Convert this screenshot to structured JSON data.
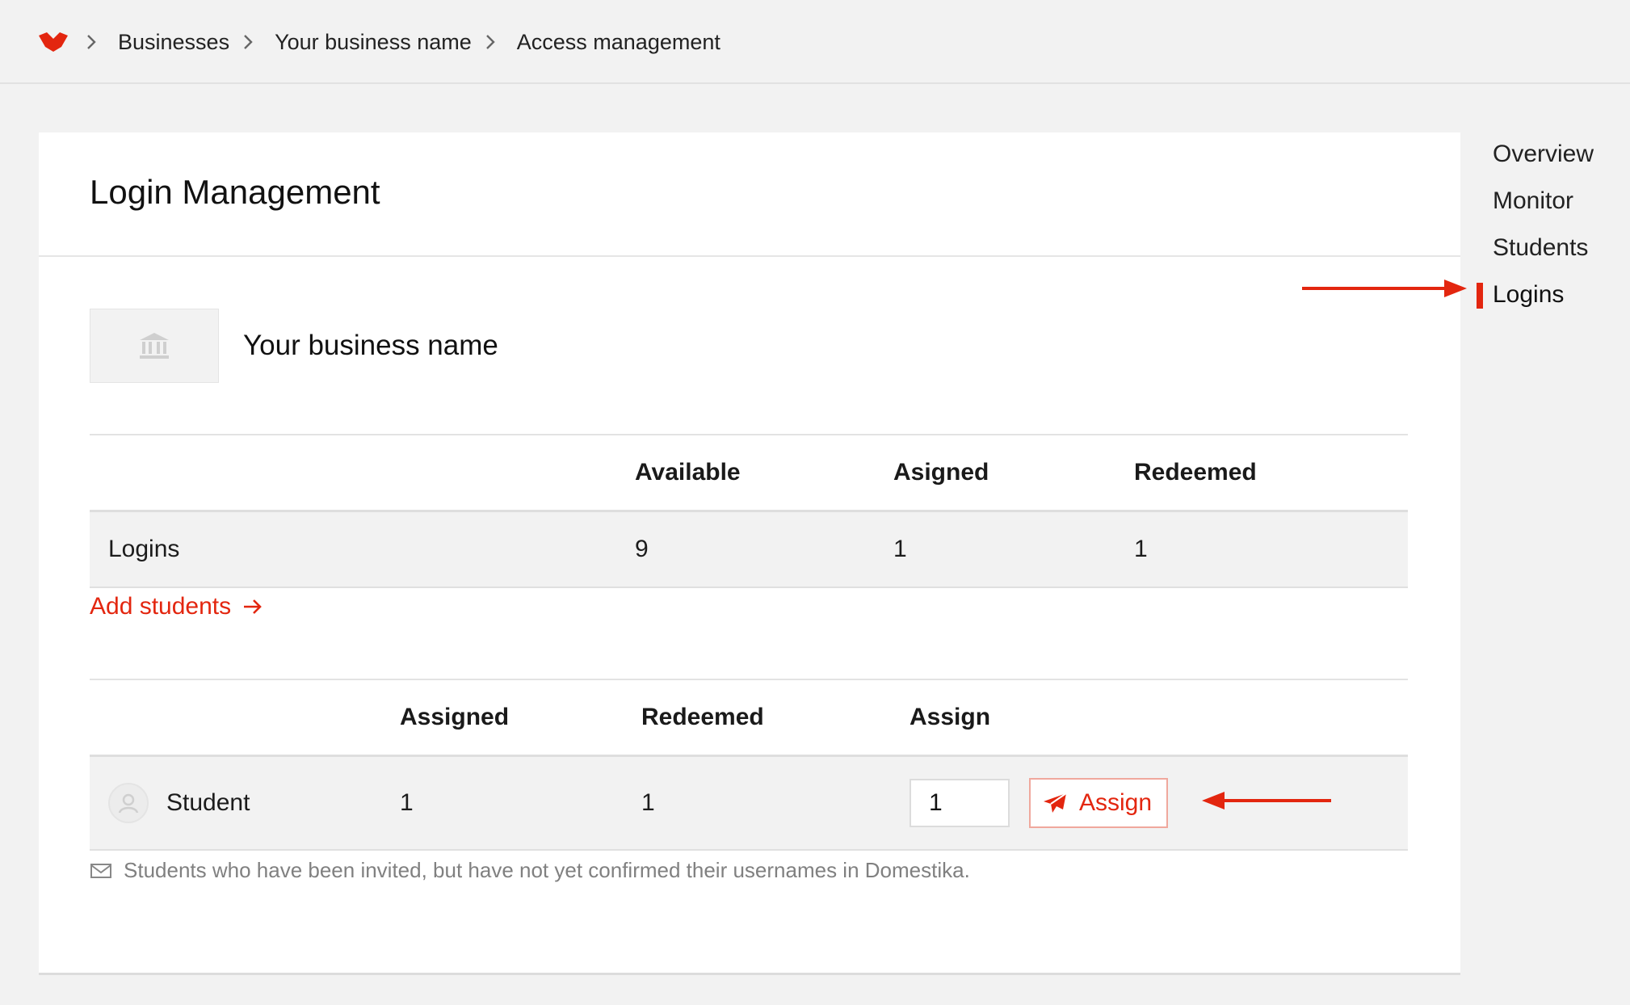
{
  "breadcrumb": {
    "items": [
      "Businesses",
      "Your business name",
      "Access management"
    ]
  },
  "card": {
    "title": "Login Management",
    "business_name": "Your business name"
  },
  "logins_table": {
    "columns": [
      "",
      "Available",
      "Asigned",
      "Redeemed"
    ],
    "row": {
      "label": "Logins",
      "available": "9",
      "asigned": "1",
      "redeemed": "1"
    }
  },
  "add_students": {
    "label": "Add students"
  },
  "students_table": {
    "columns": [
      "",
      "Assigned",
      "Redeemed",
      "Assign"
    ],
    "row": {
      "name": "Student",
      "assigned": "1",
      "redeemed": "1",
      "assign_value": "1",
      "assign_button": "Assign"
    }
  },
  "note": "Students who have been invited, but have not yet confirmed their usernames in Domestika.",
  "sidenav": {
    "items": [
      "Overview",
      "Monitor",
      "Students",
      "Logins"
    ],
    "active": "Logins"
  },
  "colors": {
    "accent": "#e3260f",
    "background": "#f2f2f2",
    "card": "#ffffff"
  },
  "icons": [
    "domestika-logo-icon",
    "chevron-right-icon",
    "bank-icon",
    "arrow-right-icon",
    "user-avatar-icon",
    "send-icon",
    "envelope-icon",
    "annotation-arrow-icon"
  ]
}
